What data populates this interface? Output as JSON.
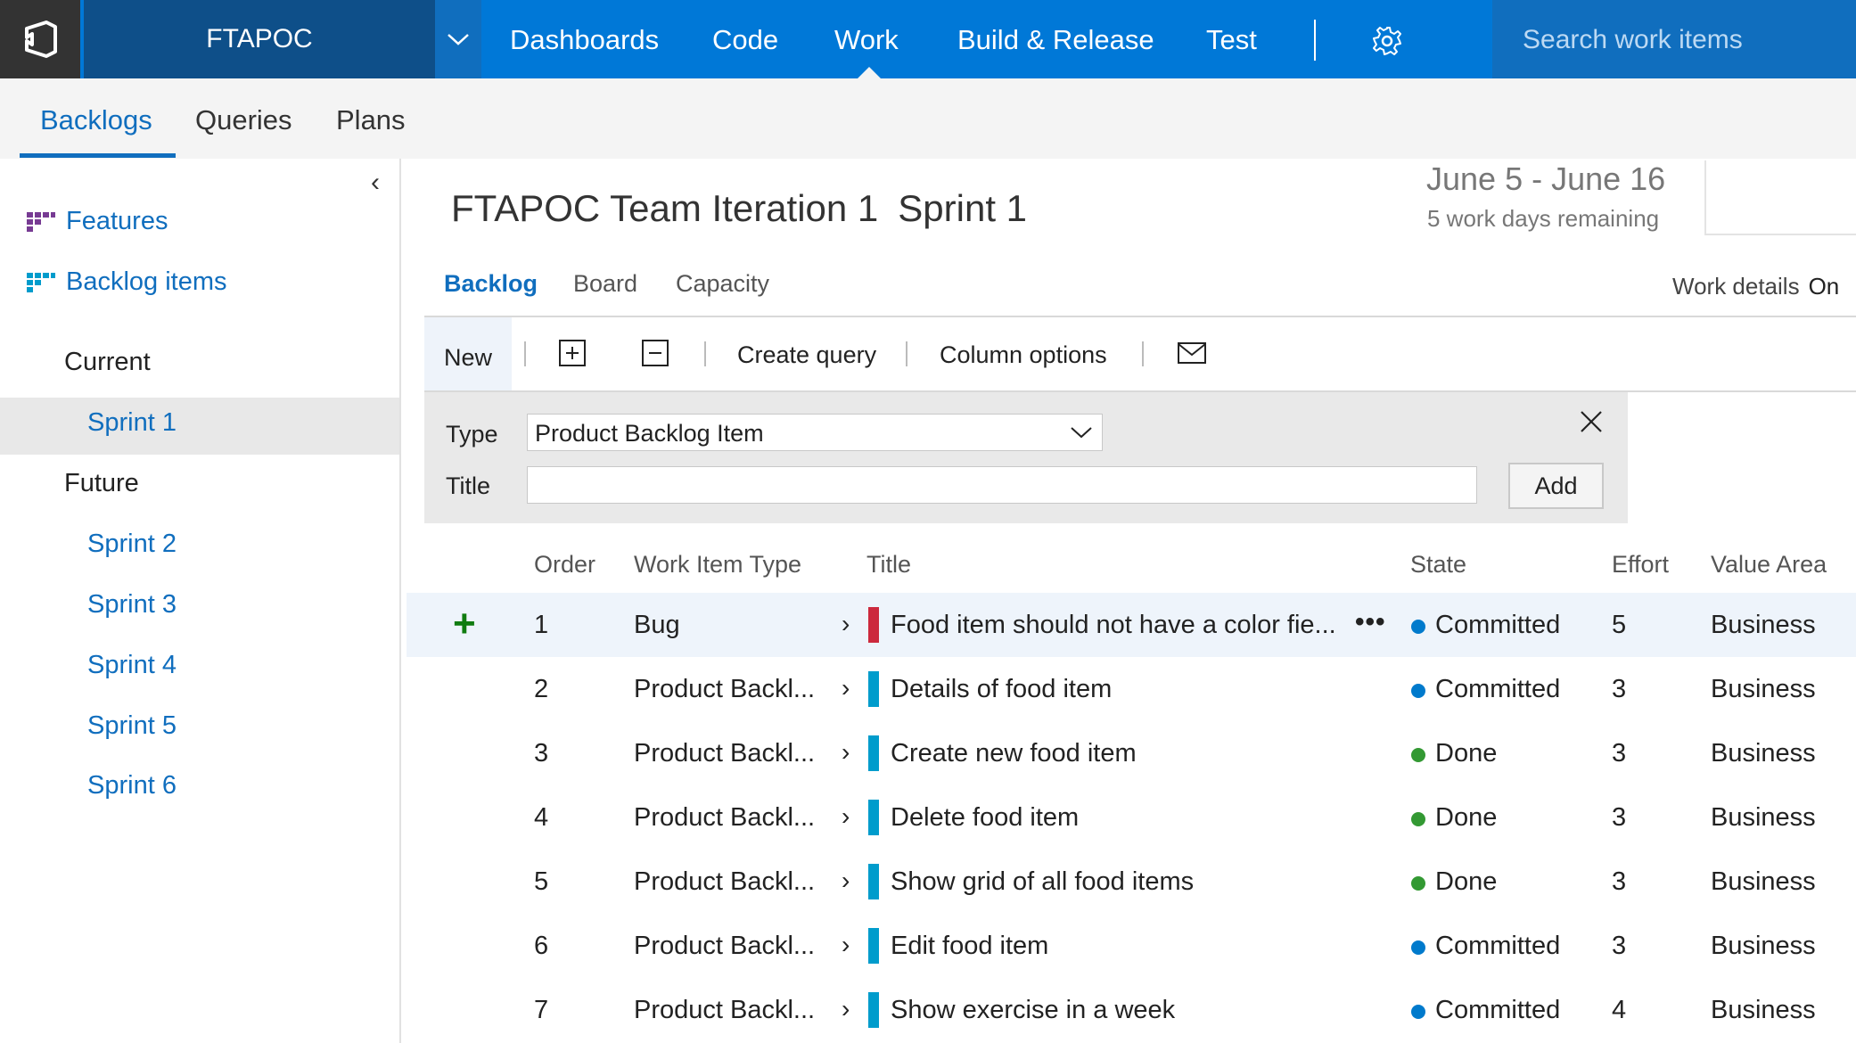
{
  "topbar": {
    "project": "FTAPOC",
    "nav": [
      "Dashboards",
      "Code",
      "Work",
      "Build & Release",
      "Test"
    ],
    "active_nav": "Work",
    "search_placeholder": "Search work items"
  },
  "subnav": {
    "tabs": [
      "Backlogs",
      "Queries",
      "Plans"
    ],
    "active": "Backlogs"
  },
  "left": {
    "features": "Features",
    "backlog_items": "Backlog items",
    "current_label": "Current",
    "current_sprint": "Sprint 1",
    "future_label": "Future",
    "future_sprints": [
      "Sprint 2",
      "Sprint 3",
      "Sprint 4",
      "Sprint 5",
      "Sprint 6"
    ]
  },
  "header": {
    "iteration": "FTAPOC Team Iteration 1",
    "sprint": "Sprint 1",
    "dates": "June 5 - June 16",
    "remaining": "5 work days remaining"
  },
  "pivots": {
    "items": [
      "Backlog",
      "Board",
      "Capacity"
    ],
    "active": "Backlog",
    "work_details_label": "Work details",
    "work_details_value": "On"
  },
  "toolbar": {
    "new": "New",
    "create_query": "Create query",
    "column_options": "Column options"
  },
  "add_form": {
    "type_label": "Type",
    "type_value": "Product Backlog Item",
    "title_label": "Title",
    "title_value": "",
    "add_button": "Add"
  },
  "grid": {
    "columns": [
      "Order",
      "Work Item Type",
      "Title",
      "State",
      "Effort",
      "Value Area"
    ],
    "rows": [
      {
        "order": "1",
        "type": "Bug",
        "title": "Food item should not have a color fie...",
        "state": "Committed",
        "effort": "5",
        "value_area": "Business",
        "type_color": "#cc293d",
        "state_color": "#007acc"
      },
      {
        "order": "2",
        "type": "Product Backl...",
        "title": "Details of food item",
        "state": "Committed",
        "effort": "3",
        "value_area": "Business",
        "type_color": "#009ccc",
        "state_color": "#007acc"
      },
      {
        "order": "3",
        "type": "Product Backl...",
        "title": "Create new food item",
        "state": "Done",
        "effort": "3",
        "value_area": "Business",
        "type_color": "#009ccc",
        "state_color": "#339933"
      },
      {
        "order": "4",
        "type": "Product Backl...",
        "title": "Delete food item",
        "state": "Done",
        "effort": "3",
        "value_area": "Business",
        "type_color": "#009ccc",
        "state_color": "#339933"
      },
      {
        "order": "5",
        "type": "Product Backl...",
        "title": "Show grid of all food items",
        "state": "Done",
        "effort": "3",
        "value_area": "Business",
        "type_color": "#009ccc",
        "state_color": "#339933"
      },
      {
        "order": "6",
        "type": "Product Backl...",
        "title": "Edit food item",
        "state": "Committed",
        "effort": "3",
        "value_area": "Business",
        "type_color": "#009ccc",
        "state_color": "#007acc"
      },
      {
        "order": "7",
        "type": "Product Backl...",
        "title": "Show exercise in a week",
        "state": "Committed",
        "effort": "4",
        "value_area": "Business",
        "type_color": "#009ccc",
        "state_color": "#007acc"
      }
    ]
  },
  "colors": {
    "brand": "#0078d7",
    "accent": "#106ebe",
    "bug": "#cc293d",
    "pbi": "#009ccc",
    "committed": "#007acc",
    "done": "#339933"
  },
  "icons": {
    "logo": "vsts-logo-icon",
    "chevron": "chevron-down-icon",
    "settings": "gear-icon",
    "expand_all": "expand-all-icon",
    "collapse_all": "collapse-all-icon",
    "email": "mail-icon",
    "close": "close-icon",
    "add_child": "plus-icon"
  }
}
